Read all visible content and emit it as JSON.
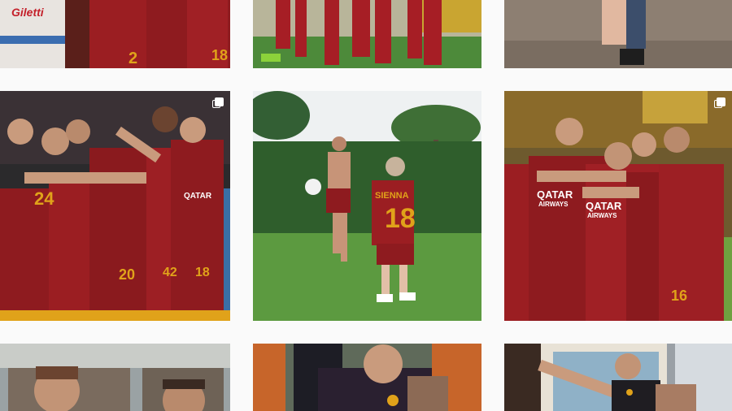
{
  "feed": {
    "posts": [
      {
        "id": "post-1",
        "jersey_text": "Giletti",
        "numbers": [
          "2",
          "18"
        ],
        "multi": false
      },
      {
        "id": "post-2",
        "multi": false
      },
      {
        "id": "post-3",
        "multi": false
      },
      {
        "id": "post-4",
        "numbers": [
          "24",
          "20",
          "42",
          "18"
        ],
        "sponsor": "QATAR",
        "multi": true
      },
      {
        "id": "post-5",
        "shirt_name": "SIENNA",
        "shirt_number": "18",
        "multi": false
      },
      {
        "id": "post-6",
        "sponsor_1": "QATAR",
        "sponsor_2": "AIRWAYS",
        "sponsor_3": "QATAR",
        "sponsor_4": "AIRWAYS",
        "number": "16",
        "multi": true
      },
      {
        "id": "post-7",
        "multi": false
      },
      {
        "id": "post-8",
        "multi": false
      },
      {
        "id": "post-9",
        "multi": false
      }
    ]
  },
  "colors": {
    "background": "#fafafa",
    "roma_red": "#8e1b1f",
    "roma_gold": "#e0a21a",
    "grass": "#4d8a3a"
  },
  "icons": {
    "multi_post": "carousel-icon"
  }
}
